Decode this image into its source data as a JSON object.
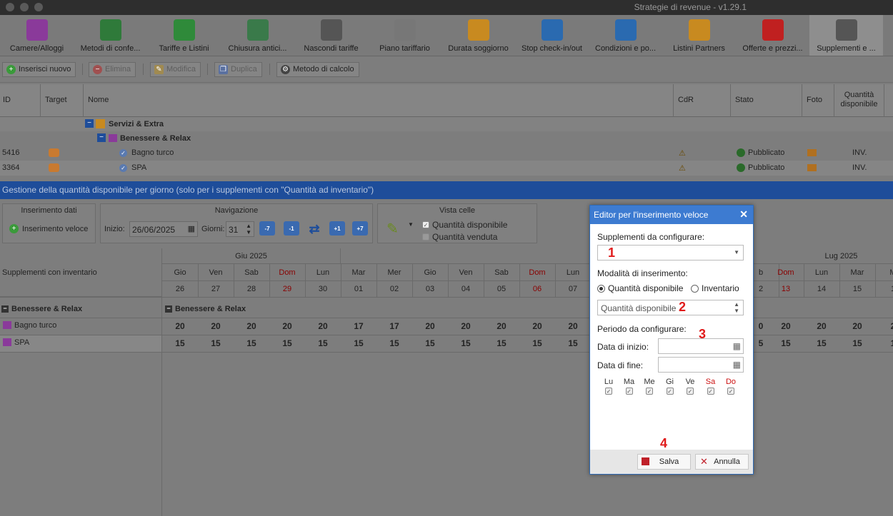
{
  "window": {
    "title": "Strategie di revenue - v1.29.1"
  },
  "tabs": [
    {
      "label": "Camere/Alloggi",
      "icon": "bed-icon",
      "color": "#8a3a9a"
    },
    {
      "label": "Metodi di confe...",
      "icon": "money-icon",
      "color": "#2f7a3a"
    },
    {
      "label": "Tariffe e Listini",
      "icon": "price-tag-icon",
      "color": "#2f8a3a"
    },
    {
      "label": "Chiusura antici...",
      "icon": "stopwatch-icon",
      "color": "#3a7a4a"
    },
    {
      "label": "Nascondi tariffe",
      "icon": "hidden-calendar-icon",
      "color": "#555"
    },
    {
      "label": "Piano tariffario",
      "icon": "grid-calendar-icon",
      "color": "#777"
    },
    {
      "label": "Durata soggiorno",
      "icon": "calendar-ruler-icon",
      "color": "#c88a20"
    },
    {
      "label": "Stop check-in/out",
      "icon": "stop-calendar-icon",
      "color": "#2a6ab0"
    },
    {
      "label": "Condizioni e po...",
      "icon": "document-icon",
      "color": "#2a6ab0"
    },
    {
      "label": "Listini Partners",
      "icon": "handshake-icon",
      "color": "#c88a20"
    },
    {
      "label": "Offerte e prezzi...",
      "icon": "percent-badge-icon",
      "color": "#c02020"
    },
    {
      "label": "Supplementi e ...",
      "icon": "service-bell-icon",
      "color": "#555"
    }
  ],
  "toolbar": {
    "insert": "Inserisci nuovo",
    "delete": "Elimina",
    "edit": "Modifica",
    "duplicate": "Duplica",
    "calc": "Metodo di calcolo"
  },
  "grid": {
    "headers": {
      "id": "ID",
      "target": "Target",
      "name": "Nome",
      "cdr": "CdR",
      "status": "Stato",
      "photo": "Foto",
      "qty": "Quantità disponibile"
    },
    "group1": "Servizi & Extra",
    "group2": "Benessere & Relax",
    "rows": [
      {
        "id": "5416",
        "name": "Bagno turco",
        "status": "Pubblicato",
        "qty": "INV."
      },
      {
        "id": "3364",
        "name": "SPA",
        "status": "Pubblicato",
        "qty": "INV."
      }
    ]
  },
  "bluebar": "Gestione della quantità disponibile per giorno (solo per i supplementi con \"Quantità ad inventario\")",
  "panels": {
    "insert": {
      "title": "Inserimento dati",
      "button": "Inserimento veloce"
    },
    "nav": {
      "title": "Navigazione",
      "start_label": "Inizio:",
      "start_value": "26/06/2025",
      "days_label": "Giorni:",
      "days_value": "31",
      "btns": [
        "-7",
        "-1",
        "+1",
        "+7"
      ]
    },
    "view": {
      "title": "Vista celle",
      "opt1": "Quantità disponibile",
      "opt2": "Quantità venduta"
    }
  },
  "calendar": {
    "left_header": "Supplementi con inventario",
    "group": "Benessere & Relax",
    "items": [
      "Bagno turco",
      "SPA"
    ],
    "months_left": "Giu 2025",
    "months_right": "Lug 2025",
    "days": [
      {
        "d": "Gio",
        "n": "26",
        "a": 20,
        "b": 15
      },
      {
        "d": "Ven",
        "n": "27",
        "a": 20,
        "b": 15
      },
      {
        "d": "Sab",
        "n": "28",
        "a": 20,
        "b": 15
      },
      {
        "d": "Dom",
        "n": "29",
        "a": 20,
        "b": 15,
        "red": true
      },
      {
        "d": "Lun",
        "n": "30",
        "a": 20,
        "b": 15
      },
      {
        "d": "Mar",
        "n": "01",
        "a": 17,
        "b": 15
      },
      {
        "d": "Mer",
        "n": "02",
        "a": 17,
        "b": 15
      },
      {
        "d": "Gio",
        "n": "03",
        "a": 20,
        "b": 15
      },
      {
        "d": "Ven",
        "n": "04",
        "a": 20,
        "b": 15
      },
      {
        "d": "Sab",
        "n": "05",
        "a": 20,
        "b": 15
      },
      {
        "d": "Dom",
        "n": "06",
        "a": 20,
        "b": 15,
        "red": true
      },
      {
        "d": "Lun",
        "n": "07",
        "a": 20,
        "b": 15
      }
    ],
    "right_days": [
      {
        "d": "b",
        "n": "2",
        "a": "0",
        "b": "5"
      },
      {
        "d": "Dom",
        "n": "13",
        "a": 20,
        "b": 15,
        "red": true
      },
      {
        "d": "Lun",
        "n": "14",
        "a": 20,
        "b": 15
      },
      {
        "d": "Mar",
        "n": "15",
        "a": 20,
        "b": 15
      },
      {
        "d": "M",
        "n": "1",
        "a": "2",
        "b": "1"
      }
    ]
  },
  "modal": {
    "title": "Editor per l'inserimento veloce",
    "supp_label": "Supplementi da configurare:",
    "mode_label": "Modalità di inserimento:",
    "radio1": "Quantità disponibile",
    "radio2": "Inventario",
    "select2": "Quantità disponibile",
    "period_label": "Periodo da configurare:",
    "start_label": "Data di inizio:",
    "end_label": "Data di fine:",
    "weekdays": [
      {
        "l": "Lu"
      },
      {
        "l": "Ma"
      },
      {
        "l": "Me"
      },
      {
        "l": "Gi"
      },
      {
        "l": "Ve"
      },
      {
        "l": "Sa",
        "red": true
      },
      {
        "l": "Do",
        "red": true
      }
    ],
    "save": "Salva",
    "cancel": "Annulla",
    "markers": [
      "1",
      "2",
      "3",
      "4"
    ]
  }
}
